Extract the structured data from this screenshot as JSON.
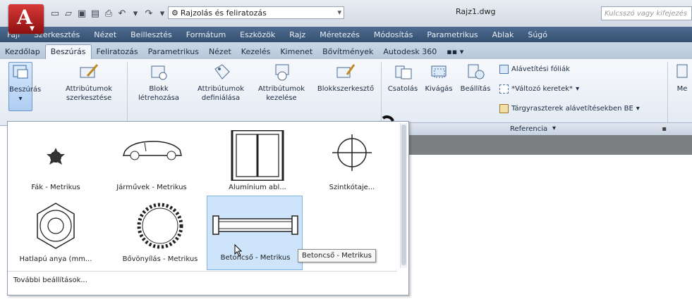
{
  "app": {
    "logo_letter": "A"
  },
  "title_bar": {
    "workspace": "Rajzolás és feliratozás",
    "doc_title": "Rajz1.dwg",
    "search_placeholder": "Kulcsszó vagy kifejezés"
  },
  "menu": [
    "Fájl",
    "Szerkesztés",
    "Nézet",
    "Beillesztés",
    "Formátum",
    "Eszközök",
    "Rajz",
    "Méretezés",
    "Módosítás",
    "Parametrikus",
    "Ablak",
    "Súgó"
  ],
  "tabs": [
    "Kezdőlap",
    "Beszúrás",
    "Feliratozás",
    "Parametrikus",
    "Nézet",
    "Kezelés",
    "Kimenet",
    "Bővítmények",
    "Autodesk 360"
  ],
  "tab_extra": "▪▪ ▾",
  "ribbon": {
    "insert_btn": "Beszúrás",
    "edit_attr_l1": "Attribútumok",
    "edit_attr_l2": "szerkesztése",
    "create_block_l1": "Blokk",
    "create_block_l2": "létrehozása",
    "define_attr_l1": "Attribútumok",
    "define_attr_l2": "definiálása",
    "manage_attr_l1": "Attribútumok",
    "manage_attr_l2": "kezelése",
    "block_editor": "Blokkszerkesztő",
    "attach": "Csatolás",
    "clip": "Kivágás",
    "adjust": "Beállítás",
    "underlay_layers": "Alávetítési fóliák",
    "frames": "*Változó keretek*",
    "snap_underlays": "Tárgyraszterek alávetítésekben BE",
    "reference_panel": "Referencia",
    "partial_label": "Me"
  },
  "gallery": {
    "items": [
      "Fák - Metrikus",
      "Járművek - Metrikus",
      "Alumínium abl...",
      "Szintkótaje...",
      "Hatlapú anya (mm...",
      "Bővönyílás - Metrikus",
      "Betoncső - Metrikus"
    ],
    "selected": "Betoncső - Metrikus",
    "more_options": "További beállítások...",
    "tooltip": "Betoncső - Metrikus"
  },
  "colors": {
    "accent": "#4f6c92",
    "selection": "#cde4fb",
    "app_red": "#c62828"
  }
}
